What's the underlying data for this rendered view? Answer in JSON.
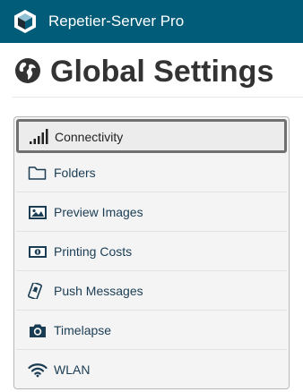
{
  "header": {
    "app_title": "Repetier-Server Pro"
  },
  "page": {
    "title": "Global Settings"
  },
  "menu": {
    "items": [
      {
        "label": "Connectivity",
        "icon": "signal-bars-icon",
        "active": true
      },
      {
        "label": "Folders",
        "icon": "folder-icon",
        "active": false
      },
      {
        "label": "Preview Images",
        "icon": "image-icon",
        "active": false
      },
      {
        "label": "Printing Costs",
        "icon": "money-bill-icon",
        "active": false
      },
      {
        "label": "Push Messages",
        "icon": "mobile-bell-icon",
        "active": false
      },
      {
        "label": "Timelapse",
        "icon": "camera-icon",
        "active": false
      },
      {
        "label": "WLAN",
        "icon": "wifi-icon",
        "active": false
      }
    ]
  },
  "colors": {
    "topbar": "#005c78",
    "title_text": "#333333",
    "menu_text": "#1a3d54"
  }
}
